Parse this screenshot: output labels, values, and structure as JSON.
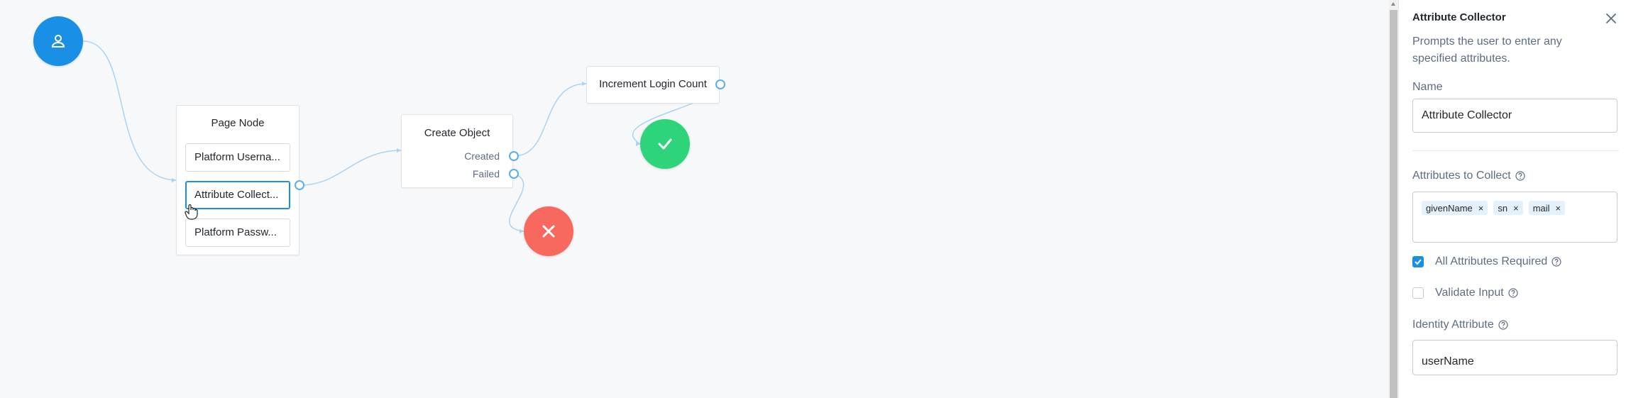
{
  "canvas": {
    "start_node": {
      "icon": "user-icon"
    },
    "page_node": {
      "title": "Page Node",
      "children": [
        "Platform Userna...",
        "Attribute Collect...",
        "Platform Passw..."
      ]
    },
    "create_object_node": {
      "title": "Create Object",
      "outcomes": [
        "Created",
        "Failed"
      ]
    },
    "increment_node": {
      "title": "Increment Login Count"
    },
    "success_node": {
      "icon": "checkmark-icon"
    },
    "failure_node": {
      "icon": "x-icon"
    }
  },
  "panel": {
    "title": "Attribute Collector",
    "description": "Prompts the user to enter any specified attributes.",
    "name_label": "Name",
    "name_value": "Attribute Collector",
    "attributes_label": "Attributes to Collect",
    "attributes": [
      "givenName",
      "sn",
      "mail"
    ],
    "all_required_label": "All Attributes Required",
    "all_required_checked": true,
    "validate_label": "Validate Input",
    "validate_checked": false,
    "identity_label": "Identity Attribute",
    "identity_value": "userName"
  },
  "colors": {
    "accent": "#1a8fe6",
    "success": "#2ed47a",
    "failure": "#f7685f",
    "wire": "#a9d3f2"
  }
}
